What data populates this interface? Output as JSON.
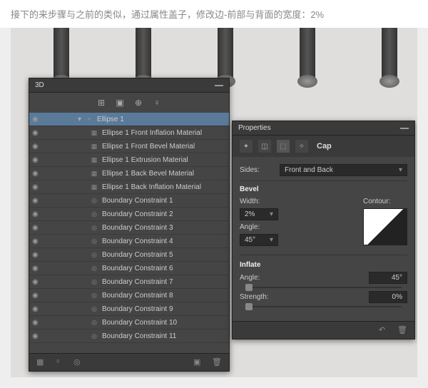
{
  "caption": "接下的来步骤与之前的类似，通过属性盖子，修改边-前部与背面的宽度：2%",
  "panel3d": {
    "title": "3D",
    "tree": [
      {
        "sel": true,
        "indent": 1,
        "icon": "poly",
        "label": "Ellipse 1"
      },
      {
        "indent": 2,
        "icon": "mat",
        "label": "Ellipse 1 Front Inflation Material"
      },
      {
        "indent": 2,
        "icon": "mat",
        "label": "Ellipse 1 Front Bevel Material"
      },
      {
        "indent": 2,
        "icon": "mat",
        "label": "Ellipse 1 Extrusion Material"
      },
      {
        "indent": 2,
        "icon": "mat",
        "label": "Ellipse 1 Back Bevel Material"
      },
      {
        "indent": 2,
        "icon": "mat",
        "label": "Ellipse 1 Back Inflation Material"
      },
      {
        "indent": 2,
        "icon": "con",
        "label": "Boundary Constraint 1"
      },
      {
        "indent": 2,
        "icon": "con",
        "label": "Boundary Constraint 2"
      },
      {
        "indent": 2,
        "icon": "con",
        "label": "Boundary Constraint 3"
      },
      {
        "indent": 2,
        "icon": "con",
        "label": "Boundary Constraint 4"
      },
      {
        "indent": 2,
        "icon": "con",
        "label": "Boundary Constraint 5"
      },
      {
        "indent": 2,
        "icon": "con",
        "label": "Boundary Constraint 6"
      },
      {
        "indent": 2,
        "icon": "con",
        "label": "Boundary Constraint 7"
      },
      {
        "indent": 2,
        "icon": "con",
        "label": "Boundary Constraint 8"
      },
      {
        "indent": 2,
        "icon": "con",
        "label": "Boundary Constraint 9"
      },
      {
        "indent": 2,
        "icon": "con",
        "label": "Boundary Constraint 10"
      },
      {
        "indent": 2,
        "icon": "con",
        "label": "Boundary Constraint 11"
      }
    ]
  },
  "props": {
    "title": "Properties",
    "tab_label": "Cap",
    "sides_label": "Sides:",
    "sides_value": "Front and Back",
    "bevel_label": "Bevel",
    "width_label": "Width:",
    "width_value": "2%",
    "angle_label": "Angle:",
    "angle_value": "45°",
    "contour_label": "Contour:",
    "inflate_label": "Inflate",
    "inflate_angle_label": "Angle:",
    "inflate_angle_value": "45°",
    "strength_label": "Strength:",
    "strength_value": "0%"
  }
}
